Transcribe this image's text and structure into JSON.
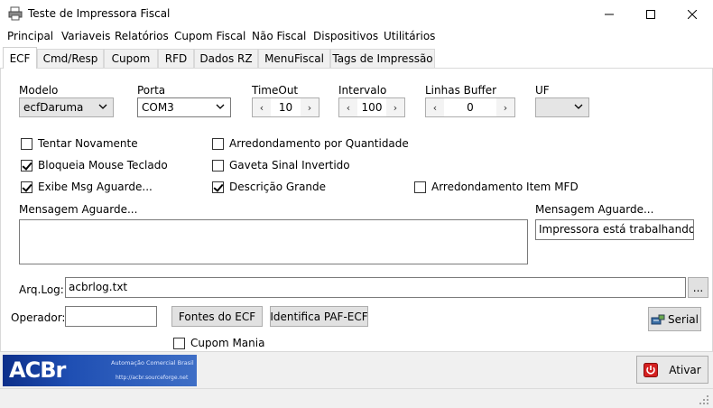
{
  "window": {
    "title": "Teste de Impressora Fiscal"
  },
  "menu": [
    "Principal",
    "Variaveis",
    "Relatórios",
    "Cupom Fiscal",
    "Não Fiscal",
    "Dispositivos",
    "Utilitários"
  ],
  "tabs": [
    "ECF",
    "Cmd/Resp",
    "Cupom",
    "RFD",
    "Dados RZ",
    "MenuFiscal",
    "Tags de Impressão"
  ],
  "active_tab": "ECF",
  "labels": {
    "modelo": "Modelo",
    "porta": "Porta",
    "timeout": "TimeOut",
    "intervalo": "Intervalo",
    "linhas_buffer": "Linhas Buffer",
    "uf": "UF",
    "mensagem_aguarde_left": "Mensagem Aguarde...",
    "mensagem_aguarde_right": "Mensagem Aguarde...",
    "arq_log": "Arq.Log:",
    "operador": "Operador:"
  },
  "fields": {
    "modelo": "ecfDaruma",
    "porta": "COM3",
    "timeout": "10",
    "intervalo": "100",
    "linhas_buffer": "0",
    "uf": "",
    "mensagem_aguarde_right": "Impressora está trabalhando",
    "arq_log": "acbrlog.txt",
    "operador": "",
    "mensagem_aguarde_memo": ""
  },
  "checkboxes": {
    "tentar_novamente": {
      "label": "Tentar Novamente",
      "checked": false
    },
    "bloqueia_mouse": {
      "label": "Bloqueia Mouse Teclado",
      "checked": true
    },
    "exibe_msg": {
      "label": "Exibe Msg Aguarde...",
      "checked": true
    },
    "arredondamento_qtd": {
      "label": "Arredondamento por Quantidade",
      "checked": false
    },
    "gaveta_sinal": {
      "label": "Gaveta Sinal Invertido",
      "checked": false
    },
    "descricao_grande": {
      "label": "Descrição Grande",
      "checked": true
    },
    "arredondamento_mfd": {
      "label": "Arredondamento Item MFD",
      "checked": false
    },
    "cupom_mania": {
      "label": "Cupom Mania",
      "checked": false
    }
  },
  "buttons": {
    "browse": "...",
    "fontes_ecf": "Fontes do ECF",
    "identifica_paf": "Identifica PAF-ECF",
    "serial": "Serial",
    "ativar": "Ativar"
  },
  "logo": {
    "brand": "ACBr",
    "tagline": "Automação Comercial Brasil",
    "url": "http://acbr.sourceforge.net"
  },
  "icons": {
    "app": "printer-icon",
    "serial": "serial-port-icon",
    "ativar": "power-icon"
  },
  "colors": {
    "logo_blue": "#1f4fb3",
    "power_red": "#d42020"
  }
}
